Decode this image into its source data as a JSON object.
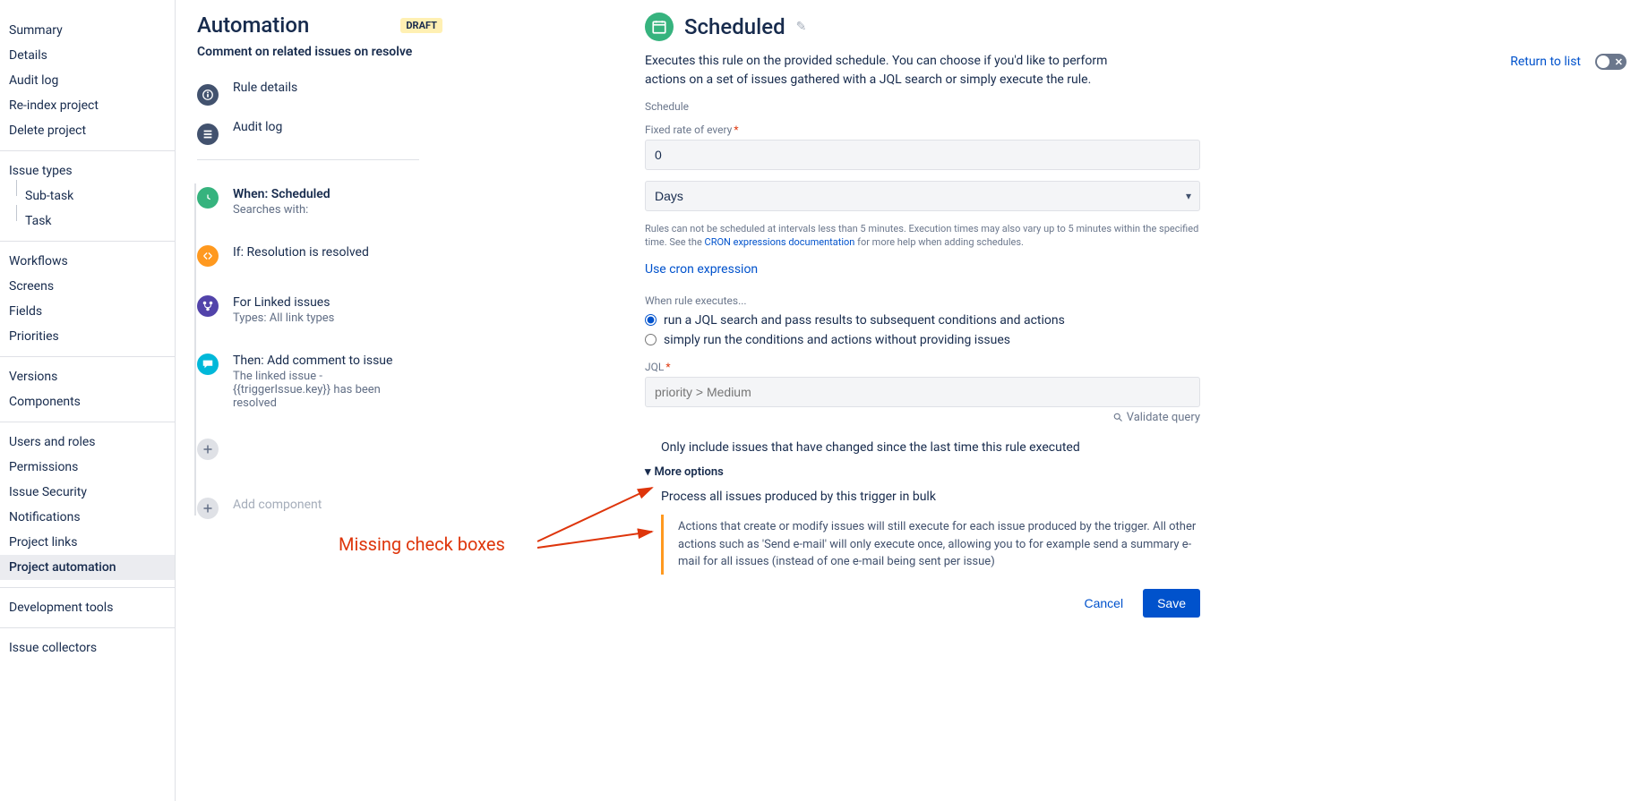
{
  "sidebar": {
    "items": [
      {
        "label": "Summary"
      },
      {
        "label": "Details"
      },
      {
        "label": "Audit log"
      },
      {
        "label": "Re-index project"
      },
      {
        "label": "Delete project"
      }
    ],
    "issue_types_label": "Issue types",
    "issue_type_subs": [
      "Sub-task",
      "Task"
    ],
    "group2": [
      "Workflows",
      "Screens",
      "Fields",
      "Priorities"
    ],
    "group3": [
      "Versions",
      "Components"
    ],
    "group4": [
      "Users and roles",
      "Permissions",
      "Issue Security",
      "Notifications",
      "Project links",
      "Project automation"
    ],
    "active": "Project automation",
    "group5": [
      "Development tools"
    ],
    "group6": [
      "Issue collectors"
    ]
  },
  "header": {
    "title": "Automation",
    "draft_badge": "DRAFT",
    "return": "Return to list",
    "rule_name": "Comment on related issues on resolve"
  },
  "steps": {
    "rule_details": "Rule details",
    "audit_log": "Audit log",
    "when_title": "When: Scheduled",
    "when_sub": "Searches with:",
    "if_title": "If: Resolution is resolved",
    "for_title": "For Linked issues",
    "for_sub": "Types: All link types",
    "then_title": "Then: Add comment to issue",
    "then_sub": "The linked issue - {{triggerIssue.key}} has been resolved",
    "add_component": "Add component"
  },
  "panel": {
    "title": "Scheduled",
    "desc": "Executes this rule on the provided schedule. You can choose if you'd like to perform actions on a set of issues gathered with a JQL search or simply execute the rule.",
    "schedule_label": "Schedule",
    "fixed_rate_label": "Fixed rate of every",
    "fixed_rate_value": "0",
    "unit_value": "Days",
    "help1": "Rules can not be scheduled at intervals less than 5 minutes. Execution times may also vary up to 5 minutes within the specified time. See the ",
    "help1_link": "CRON expressions documentation",
    "help1_suffix": " for more help when adding schedules.",
    "use_cron": "Use cron expression",
    "when_exec_label": "When rule executes...",
    "radio1": "run a JQL search and pass results to subsequent conditions and actions",
    "radio2": "simply run the conditions and actions without providing issues",
    "jql_label": "JQL",
    "jql_placeholder": "priority > Medium",
    "validate": "Validate query",
    "check1": "Only include issues that have changed since the last time this rule executed",
    "more_options": "More options",
    "check2": "Process all issues produced by this trigger in bulk",
    "bulk_info": "Actions that create or modify issues will still execute for each issue produced by the trigger. All other actions such as 'Send e-mail' will only execute once, allowing you to for example send a summary e-mail for all issues (instead of one e-mail being sent per issue)",
    "cancel": "Cancel",
    "save": "Save"
  },
  "annotation": {
    "text": "Missing check boxes"
  }
}
